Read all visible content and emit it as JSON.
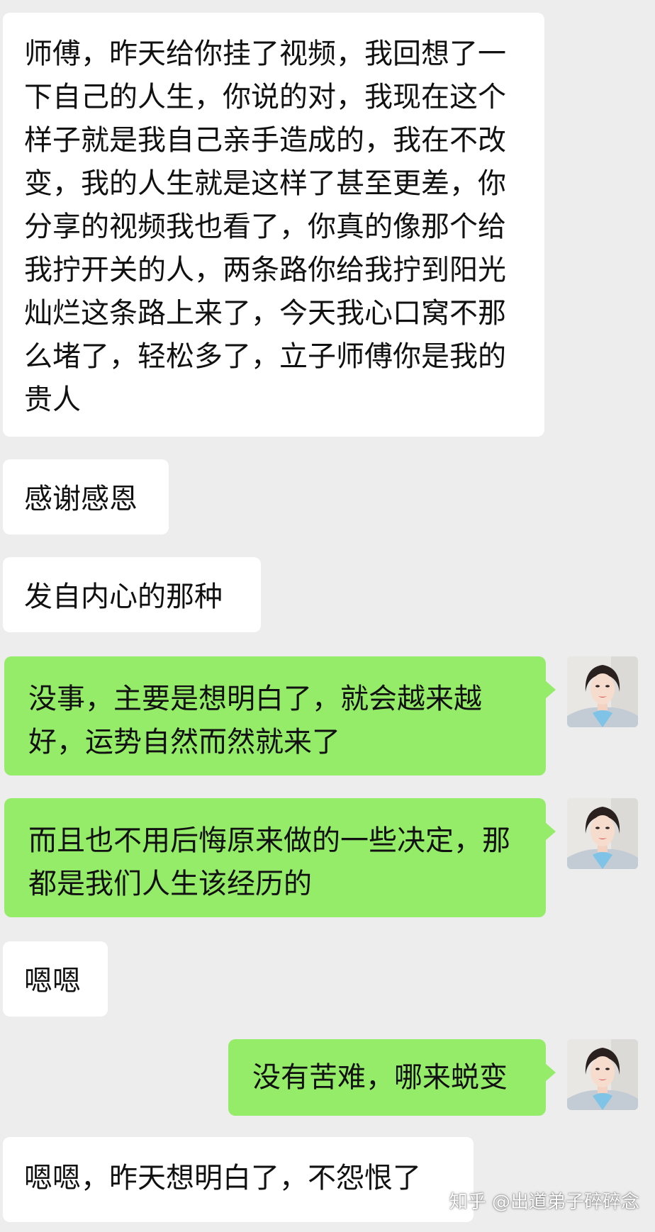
{
  "chat": {
    "messages": [
      {
        "side": "incoming",
        "text": "师傅，昨天给你挂了视频，我回想了一下自己的人生，你说的对，我现在这个样子就是我自己亲手造成的，我在不改变，我的人生就是这样了甚至更差，你分享的视频我也看了，你真的像那个给我拧开关的人，两条路你给我拧到阳光灿烂这条路上来了，今天我心口窝不那么堵了，轻松多了，立子师傅你是我的贵人"
      },
      {
        "side": "incoming",
        "text": "感谢感恩"
      },
      {
        "side": "incoming",
        "text": "发自内心的那种"
      },
      {
        "side": "outgoing",
        "text": "没事，主要是想明白了，就会越来越好，运势自然而然就来了",
        "avatar_icon": "profile-photo-woman-icon"
      },
      {
        "side": "outgoing",
        "text": "而且也不用后悔原来做的一些决定，那都是我们人生该经历的",
        "avatar_icon": "profile-photo-woman-icon"
      },
      {
        "side": "incoming",
        "text": "嗯嗯"
      },
      {
        "side": "outgoing",
        "text": "没有苦难，哪来蜕变",
        "avatar_icon": "profile-photo-woman-icon"
      },
      {
        "side": "incoming",
        "text": "嗯嗯，昨天想明白了，不怨恨了"
      }
    ]
  },
  "watermark": {
    "text": "知乎 @出道弟子碎碎念"
  },
  "colors": {
    "background": "#ededed",
    "incoming_bubble": "#ffffff",
    "outgoing_bubble": "#95ec69",
    "text": "#111111"
  }
}
